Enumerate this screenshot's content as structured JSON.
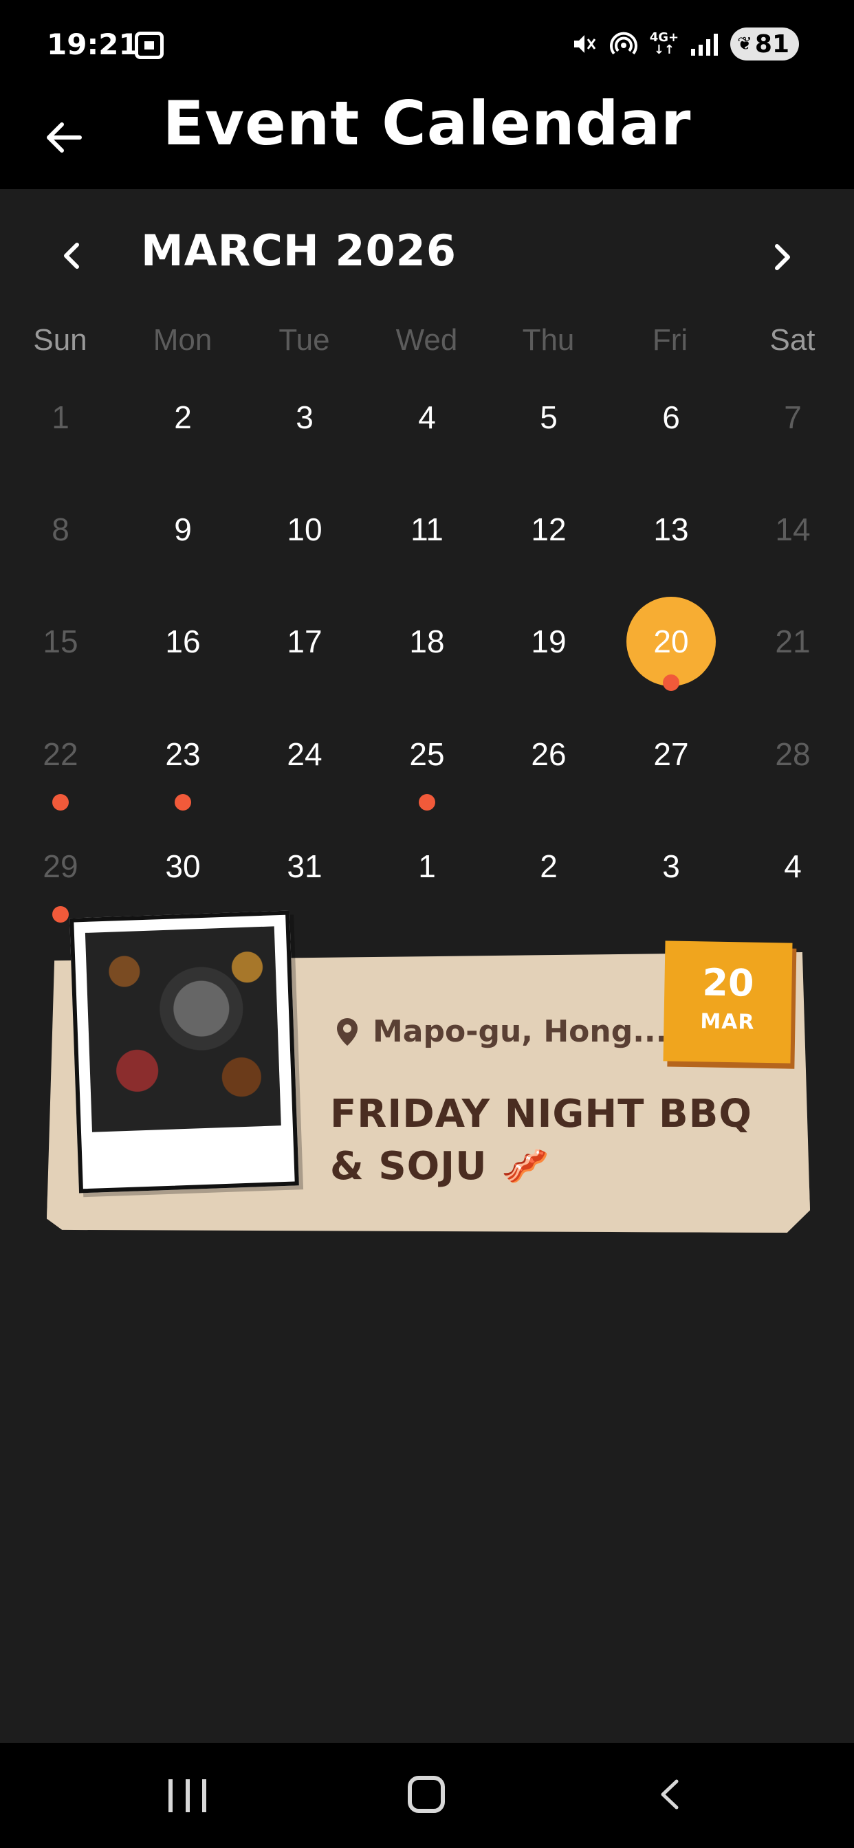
{
  "status_bar": {
    "time": "19:21",
    "network": "4G+",
    "battery": "81",
    "icons": [
      "screenshot-icon",
      "mute-icon",
      "hotspot-icon",
      "signal-icon",
      "battery-icon"
    ]
  },
  "header": {
    "title": "Event Calendar",
    "back_icon": "back-arrow-icon"
  },
  "calendar": {
    "month_label": "MARCH 2026",
    "weekdays": [
      "Sun",
      "Mon",
      "Tue",
      "Wed",
      "Thu",
      "Fri",
      "Sat"
    ],
    "weeks": [
      [
        {
          "n": "1",
          "muted": true
        },
        {
          "n": "2"
        },
        {
          "n": "3"
        },
        {
          "n": "4"
        },
        {
          "n": "5"
        },
        {
          "n": "6"
        },
        {
          "n": "7",
          "muted": true
        }
      ],
      [
        {
          "n": "8",
          "muted": true
        },
        {
          "n": "9"
        },
        {
          "n": "10"
        },
        {
          "n": "11"
        },
        {
          "n": "12"
        },
        {
          "n": "13"
        },
        {
          "n": "14",
          "muted": true
        }
      ],
      [
        {
          "n": "15",
          "muted": true
        },
        {
          "n": "16"
        },
        {
          "n": "17"
        },
        {
          "n": "18"
        },
        {
          "n": "19"
        },
        {
          "n": "20",
          "selected": true,
          "dot": true
        },
        {
          "n": "21",
          "muted": true
        }
      ],
      [
        {
          "n": "22",
          "muted": true,
          "dot": true
        },
        {
          "n": "23",
          "dot": true
        },
        {
          "n": "24"
        },
        {
          "n": "25",
          "dot": true
        },
        {
          "n": "26"
        },
        {
          "n": "27"
        },
        {
          "n": "28",
          "muted": true
        }
      ],
      [
        {
          "n": "29",
          "muted": true,
          "dot": true
        },
        {
          "n": "30"
        },
        {
          "n": "31"
        },
        {
          "n": "1"
        },
        {
          "n": "2"
        },
        {
          "n": "3"
        },
        {
          "n": "4"
        }
      ]
    ],
    "accent_color": "#f7ad33",
    "event_dot_color": "#f15a3a"
  },
  "event_card": {
    "location": "Mapo-gu, Hong...",
    "title": "FRIDAY NIGHT BBQ & SOJU",
    "emoji": "🥓",
    "date_day": "20",
    "date_month": "MAR"
  },
  "nav_bar": {
    "icons": [
      "recent-apps-icon",
      "home-icon",
      "back-icon"
    ]
  }
}
